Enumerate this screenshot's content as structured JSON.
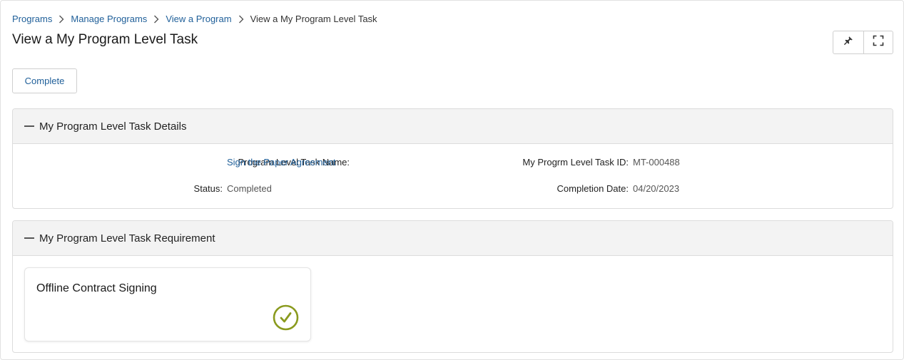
{
  "breadcrumb": {
    "items": [
      "Programs",
      "Manage Programs",
      "View a Program"
    ],
    "current": "View a My Program Level Task"
  },
  "page_title": "View a My Program Level Task",
  "top_actions": {
    "icons": [
      "pin-icon",
      "expand-icon"
    ]
  },
  "complete_button": "Complete",
  "details_section": {
    "title": "My Program Level Task Details",
    "fields": {
      "task_name_label": "Program Level Task Name:",
      "task_name_value": "Sign the Paper Agreement",
      "task_id_label": "My Progrm Level Task ID:",
      "task_id_value": "MT-000488",
      "status_label": "Status:",
      "status_value": "Completed",
      "completion_date_label": "Completion Date:",
      "completion_date_value": "04/20/2023"
    }
  },
  "requirement_section": {
    "title": "My Program Level Task Requirement",
    "card": {
      "title": "Offline Contract Signing",
      "status_icon": "check-circle-icon"
    }
  },
  "colors": {
    "link": "#1f5f99",
    "header_bg": "#f3f3f3",
    "check": "#8a9a1e",
    "border": "#dcdcdc"
  }
}
